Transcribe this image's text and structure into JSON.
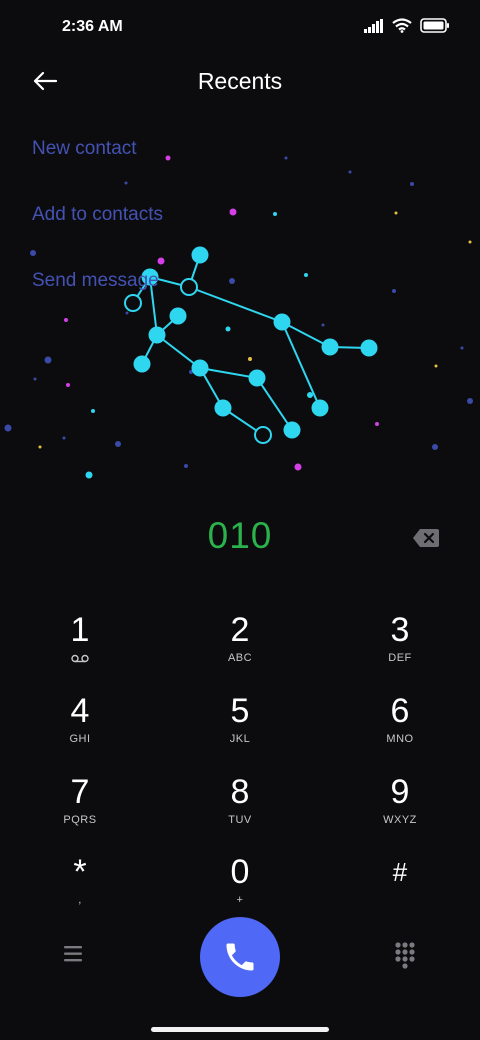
{
  "status": {
    "time": "2:36 AM",
    "icons": [
      "signal-icon",
      "wifi-icon",
      "battery-icon"
    ]
  },
  "header": {
    "title": "Recents",
    "back_icon": "arrow-left-icon"
  },
  "actions": {
    "new_contact": "New contact",
    "add_to_contacts": "Add to contacts",
    "send_message": "Send message"
  },
  "dial": {
    "number": "010",
    "backspace_icon": "backspace-icon"
  },
  "keys": [
    {
      "digit": "1",
      "letters": ""
    },
    {
      "digit": "2",
      "letters": "ABC"
    },
    {
      "digit": "3",
      "letters": "DEF"
    },
    {
      "digit": "4",
      "letters": "GHI"
    },
    {
      "digit": "5",
      "letters": "JKL"
    },
    {
      "digit": "6",
      "letters": "MNO"
    },
    {
      "digit": "7",
      "letters": "PQRS"
    },
    {
      "digit": "8",
      "letters": "TUV"
    },
    {
      "digit": "9",
      "letters": "WXYZ"
    },
    {
      "digit": "*",
      "letters": ","
    },
    {
      "digit": "0",
      "letters": "+"
    },
    {
      "digit": "#",
      "letters": ""
    }
  ],
  "bottom": {
    "menu_icon": "menu-icon",
    "call_icon": "phone-icon",
    "dialpad_icon": "dialpad-icon"
  },
  "colors": {
    "background": "#0c0c0e",
    "link": "#4452b3",
    "dial_number": "#2bb24c",
    "call_button": "#5068f6",
    "constellation": "#2fd6f0"
  }
}
